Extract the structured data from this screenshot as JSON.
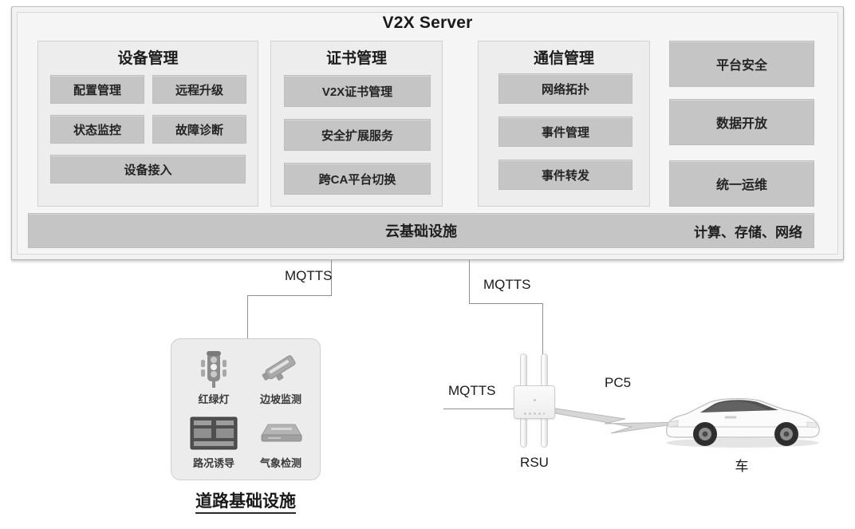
{
  "server": {
    "title": "V2X Server",
    "groups": [
      {
        "name": "device-management",
        "title": "设备管理",
        "tiles": [
          "配置管理",
          "远程升级",
          "状态监控",
          "故障诊断",
          "设备接入"
        ]
      },
      {
        "name": "certificate-management",
        "title": "证书管理",
        "tiles": [
          "V2X证书管理",
          "安全扩展服务",
          "跨CA平台切换"
        ]
      },
      {
        "name": "communication-management",
        "title": "通信管理",
        "tiles": [
          "网络拓扑",
          "事件管理",
          "事件转发"
        ]
      }
    ],
    "solo_tiles": [
      "平台安全",
      "数据开放",
      "统一运维"
    ],
    "cloud": {
      "center_label": "云基础设施",
      "right_label": "计算、存储、网络"
    }
  },
  "connections": {
    "left_protocol": "MQTTS",
    "right_protocol": "MQTTS",
    "rsu_protocol": "MQTTS",
    "pc5_protocol": "PC5"
  },
  "road_infrastructure": {
    "label": "道路基础设施",
    "items": [
      {
        "icon": "traffic-light-icon",
        "label": "红绿灯"
      },
      {
        "icon": "slope-monitoring-camera-icon",
        "label": "边坡监测"
      },
      {
        "icon": "traffic-guidance-board-icon",
        "label": "路况诱导"
      },
      {
        "icon": "weather-detection-icon",
        "label": "气象检测"
      }
    ]
  },
  "rsu": {
    "label": "RSU"
  },
  "vehicle": {
    "label": "车"
  },
  "colors": {
    "tile_gray": "#c5c5c5",
    "group_bg": "#ededed",
    "frame_bg": "#f2f2f2",
    "line": "#8f8f8f",
    "text": "#1a1a1a"
  }
}
